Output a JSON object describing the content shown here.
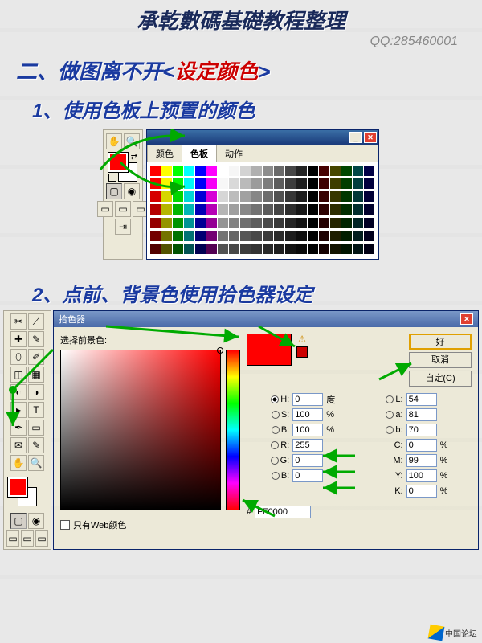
{
  "title": "承乾數碼基礎教程整理",
  "qq": "QQ:285460001",
  "heading_pre": "二、做图离不开<",
  "heading_hl": "设定颜色",
  "heading_post": ">",
  "sub1": "1、使用色板上预置的颜色",
  "sub2": "2、点前、背景色使用拾色器设定",
  "palette": {
    "tabs": {
      "color": "颜色",
      "swatch": "色板",
      "action": "动作"
    }
  },
  "picker": {
    "title": "拾色器",
    "label": "选择前景色:",
    "ok": "好",
    "cancel": "取消",
    "custom": "自定(C)",
    "web_only": "只有Web颜色",
    "fields": {
      "H": {
        "label": "H:",
        "value": "0",
        "unit": "度"
      },
      "S": {
        "label": "S:",
        "value": "100",
        "unit": "%"
      },
      "Bv": {
        "label": "B:",
        "value": "100",
        "unit": "%"
      },
      "L": {
        "label": "L:",
        "value": "54"
      },
      "a": {
        "label": "a:",
        "value": "81"
      },
      "b": {
        "label": "b:",
        "value": "70"
      },
      "R": {
        "label": "R:",
        "value": "255"
      },
      "G": {
        "label": "G:",
        "value": "0"
      },
      "Bl": {
        "label": "B:",
        "value": "0"
      },
      "C": {
        "label": "C:",
        "value": "0",
        "unit": "%"
      },
      "M": {
        "label": "M:",
        "value": "99",
        "unit": "%"
      },
      "Y": {
        "label": "Y:",
        "value": "100",
        "unit": "%"
      },
      "K": {
        "label": "K:",
        "value": "0",
        "unit": "%"
      }
    },
    "hex_label": "#",
    "hex": "FF0000"
  },
  "footer": "中国论坛"
}
